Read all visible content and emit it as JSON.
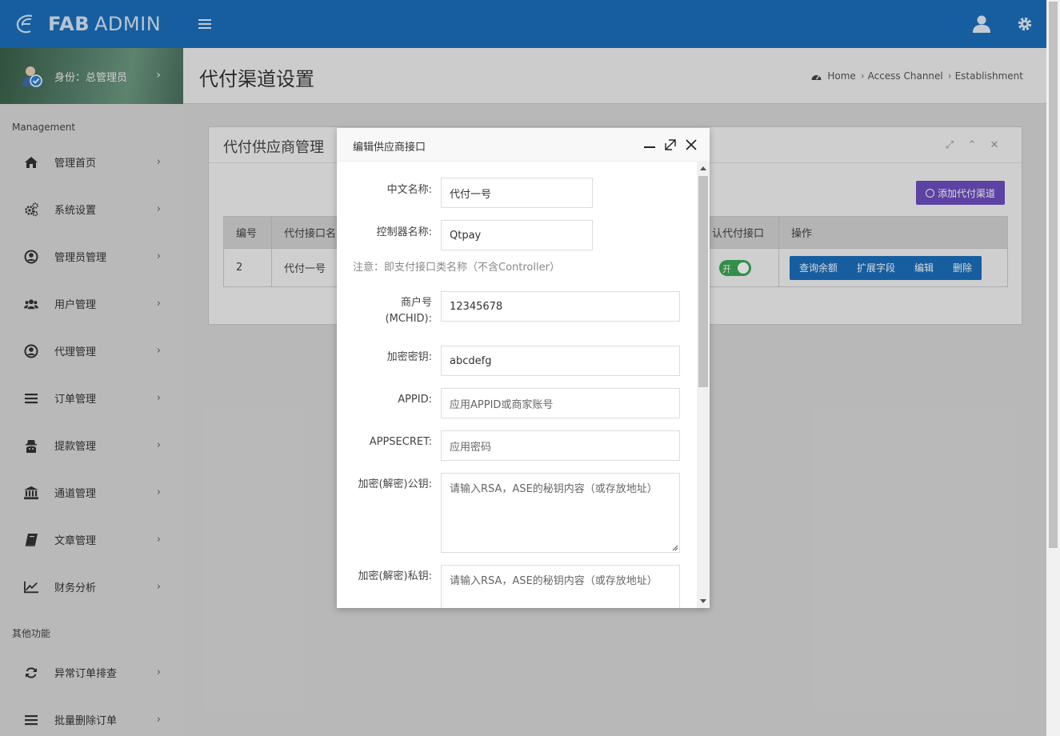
{
  "brand": {
    "bold": "FAB",
    "rest": "ADMIN"
  },
  "user": {
    "role_label": "身份：总管理员"
  },
  "sidebar": {
    "section1": "Management",
    "items": [
      {
        "label": "管理首页",
        "icon": "home-icon"
      },
      {
        "label": "系统设置",
        "icon": "cogs-icon"
      },
      {
        "label": "管理员管理",
        "icon": "user-circle-icon"
      },
      {
        "label": "用户管理",
        "icon": "users-icon"
      },
      {
        "label": "代理管理",
        "icon": "user-circle-icon"
      },
      {
        "label": "订单管理",
        "icon": "list-icon"
      },
      {
        "label": "提款管理",
        "icon": "spy-icon"
      },
      {
        "label": "通道管理",
        "icon": "bank-icon"
      },
      {
        "label": "文章管理",
        "icon": "book-icon"
      },
      {
        "label": "财务分析",
        "icon": "line-chart-icon"
      }
    ],
    "section2": "其他功能",
    "items2": [
      {
        "label": "异常订单排查",
        "icon": "refresh-icon"
      },
      {
        "label": "批量删除订单",
        "icon": "list-icon"
      }
    ]
  },
  "header": {
    "page_title": "代付渠道设置",
    "breadcrumb": [
      "Home",
      "Access Channel",
      "Establishment"
    ]
  },
  "card": {
    "title": "代付供应商管理",
    "add_button": "添加代付渠道",
    "table": {
      "headers": [
        "编号",
        "代付接口名",
        "认代付接口",
        "操作"
      ],
      "row": {
        "id": "2",
        "name": "代付一号",
        "toggle": "开"
      },
      "ops": [
        "查询余额",
        "扩展字段",
        "编辑",
        "删除"
      ]
    }
  },
  "modal": {
    "title": "编辑供应商接口",
    "fields": {
      "cn_name": {
        "label": "中文名称:",
        "value": "代付一号"
      },
      "controller": {
        "label": "控制器名称:",
        "value": "Qtpay"
      },
      "note": "注意：即支付接口类名称（不含Controller）",
      "mchid": {
        "label1": "商户号",
        "label2": "(MCHID):",
        "value": "12345678"
      },
      "secret_key": {
        "label": "加密密钥:",
        "value": "abcdefg"
      },
      "appid": {
        "label": "APPID:",
        "placeholder": "应用APPID或商家账号"
      },
      "appsecret": {
        "label": "APPSECRET:",
        "placeholder": "应用密码"
      },
      "public_key": {
        "label": "加密(解密)公钥:",
        "placeholder": "请输入RSA，ASE的秘钥内容（或存放地址）"
      },
      "private_key": {
        "label": "加密(解密)私钥:",
        "placeholder": "请输入RSA，ASE的秘钥内容（或存放地址）"
      }
    }
  },
  "colors": {
    "topbar": "#1a6fbd",
    "add_button": "#6d4ec0",
    "toggle_on": "#3aa855",
    "ops": "#1a6fbd"
  }
}
